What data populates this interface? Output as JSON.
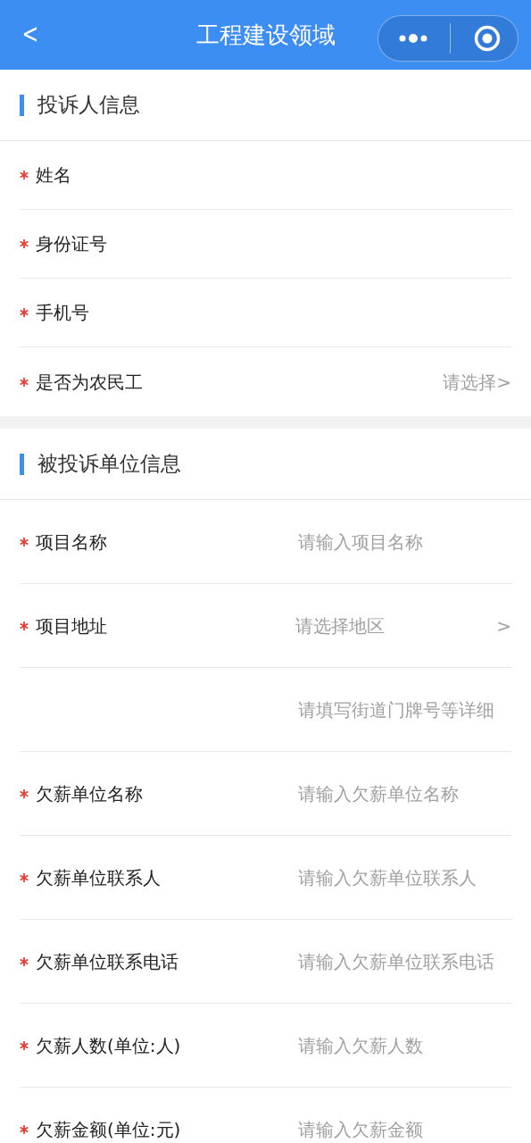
{
  "nav": {
    "back": "<",
    "title": "工程建设领域"
  },
  "sections": [
    {
      "title": "投诉人信息",
      "rows": [
        {
          "kind": "input",
          "label": "姓名",
          "required": true
        },
        {
          "kind": "input",
          "label": "身份证号",
          "required": true
        },
        {
          "kind": "input",
          "label": "手机号",
          "required": true
        },
        {
          "kind": "picker",
          "label": "是否为农民工",
          "required": true,
          "placeholder": "请选择>"
        }
      ]
    },
    {
      "title": "被投诉单位信息",
      "rows": [
        {
          "kind": "input",
          "label": "项目名称",
          "required": true,
          "placeholder": "请输入项目名称"
        },
        {
          "kind": "region",
          "label": "项目地址",
          "required": true,
          "placeholder": "请选择地区",
          "arrow": ">"
        },
        {
          "kind": "input",
          "required": false,
          "placeholder": "请填写街道门牌号等详细"
        },
        {
          "kind": "input",
          "label": "欠薪单位名称",
          "required": true,
          "placeholder": "请输入欠薪单位名称"
        },
        {
          "kind": "input",
          "label": "欠薪单位联系人",
          "required": true,
          "placeholder": "请输入欠薪单位联系人"
        },
        {
          "kind": "input",
          "label": "欠薪单位联系电话",
          "required": true,
          "placeholder": "请输入欠薪单位联系电话"
        },
        {
          "kind": "input",
          "label": "欠薪人数(单位:人)",
          "required": true,
          "placeholder": "请输入欠薪人数"
        },
        {
          "kind": "input",
          "label": "欠薪金额(单位:元)",
          "required": true,
          "placeholder": "请输入欠薪金额"
        }
      ]
    }
  ]
}
